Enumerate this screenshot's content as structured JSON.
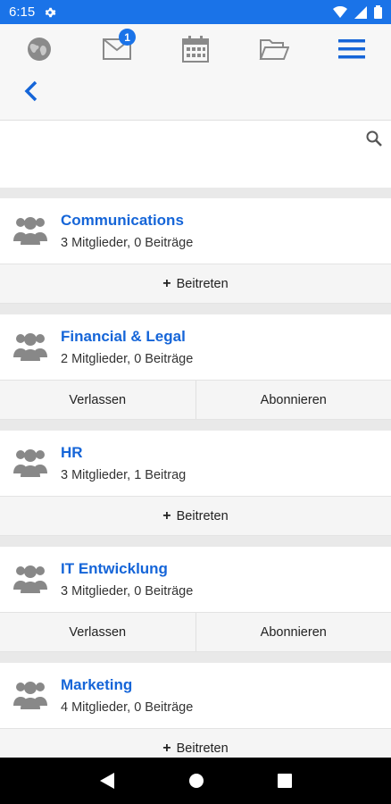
{
  "status": {
    "time": "6:15"
  },
  "nav": {
    "badge_count": "1"
  },
  "groups": [
    {
      "name": "Communications",
      "stats": "3 Mitglieder, 0 Beiträge",
      "actions": [
        "Beitreten"
      ]
    },
    {
      "name": "Financial & Legal",
      "stats": "2 Mitglieder, 0 Beiträge",
      "actions": [
        "Verlassen",
        "Abonnieren"
      ]
    },
    {
      "name": "HR",
      "stats": "3 Mitglieder, 1 Beitrag",
      "actions": [
        "Beitreten"
      ]
    },
    {
      "name": "IT Entwicklung",
      "stats": "3 Mitglieder, 0 Beiträge",
      "actions": [
        "Verlassen",
        "Abonnieren"
      ]
    },
    {
      "name": "Marketing",
      "stats": "4 Mitglieder, 0 Beiträge",
      "actions": [
        "Beitreten"
      ]
    }
  ],
  "colors": {
    "accent": "#1a73e8",
    "link": "#1565d8"
  }
}
